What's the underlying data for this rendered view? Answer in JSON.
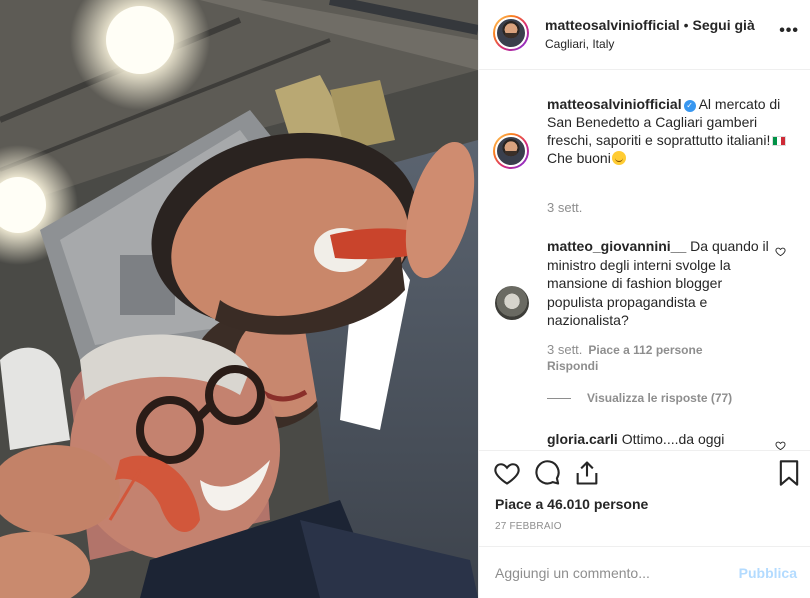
{
  "post": {
    "photo_alt": "Selfie al mercato",
    "author": "matteosalviniofficial",
    "separator": "•",
    "follow_label": "Segui già",
    "location": "Cagliari, Italy",
    "more_icon": "more-horizontal-icon"
  },
  "caption": {
    "username": "matteosalviniofficial",
    "text": "Al mercato di San Benedetto a Cagliari gamberi freschi, saporiti e soprattutto italiani!",
    "text2": "Che buoni",
    "time": "3 sett."
  },
  "comments": [
    {
      "username": "matteo_giovannini__",
      "text": "Da quando il ministro degli interni svolge la mansione di fashion blogger populista propagandista e nazionalista?",
      "time": "3 sett.",
      "likes": "Piace a 112 persone",
      "reply": "Rispondi",
      "view_replies": "Visualizza le risposte (77)"
    },
    {
      "username": "gloria.carli",
      "text": "Ottimo....da oggi"
    }
  ],
  "footer": {
    "likes": "Piace a 46.010 persone",
    "date": "27 FEBBRAIO",
    "comment_placeholder": "Aggiungi un commento...",
    "publish_label": "Pubblica"
  },
  "colors": {
    "accent": "#3897f0",
    "muted": "#8e8e8e",
    "text": "#262626",
    "publish_disabled": "#b3dbff"
  }
}
